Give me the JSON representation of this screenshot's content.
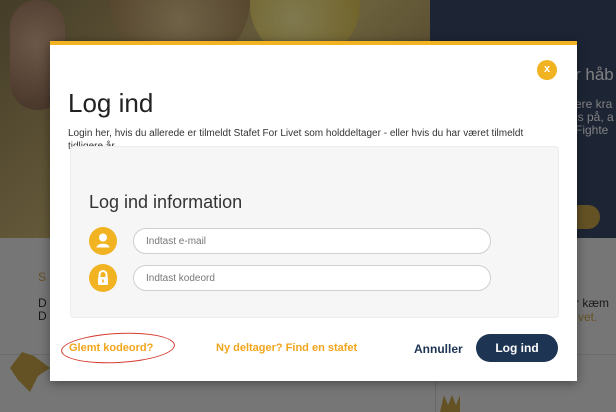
{
  "background": {
    "right_panel_lines": [
      "r håb",
      "ere kra",
      "is på, a",
      "Fighte"
    ],
    "lower_left_lines": [
      "S",
      "D",
      "D"
    ],
    "lower_right_lines": [
      "r kæm",
      "vet."
    ]
  },
  "modal": {
    "close_label": "x",
    "title": "Log ind",
    "intro": "Login her, hvis du allerede er tilmeldt Stafet For Livet som holddeltager - eller hvis du har været tilmeldt tidligere år.",
    "card": {
      "title": "Log ind information",
      "email_placeholder": "Indtast e-mail",
      "password_placeholder": "Indtast kodeord"
    },
    "footer": {
      "forgot_label": "Glemt kodeord?",
      "new_user_label": "Ny deltager? Find en stafet",
      "cancel_label": "Annuller",
      "login_label": "Log ind"
    }
  },
  "colors": {
    "accent": "#f1b321",
    "navy": "#1e3453",
    "annotation": "#d63b2f"
  },
  "icons": {
    "close": "close-icon",
    "user": "user-icon",
    "lock": "lock-icon"
  }
}
